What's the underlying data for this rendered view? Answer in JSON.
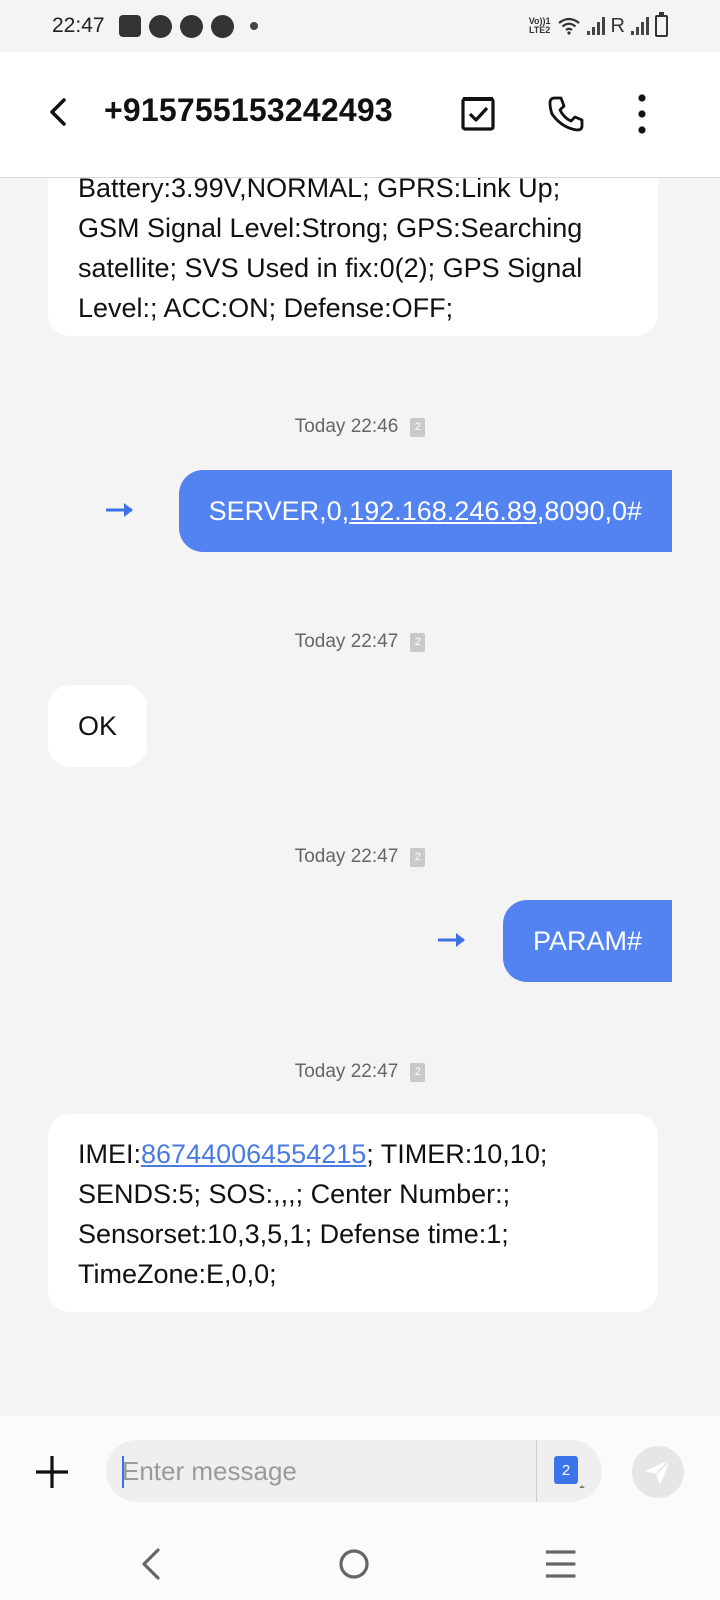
{
  "status_bar": {
    "time": "22:47",
    "network_label": "Vo)) 1 LTE2",
    "roaming": "R"
  },
  "header": {
    "title": "+915755153242493"
  },
  "messages": [
    {
      "kind": "incoming",
      "lines": [
        "Battery:3.99V,NORMAL; GPRS:Link Up;",
        "GSM Signal Level:Strong; GPS:Searching",
        "satellite; SVS Used in fix:0(2); GPS Signal",
        "Level:; ACC:ON; Defense:OFF;"
      ]
    },
    {
      "kind": "timestamp",
      "text": "Today 22:46",
      "sim": "2"
    },
    {
      "kind": "outgoing",
      "prefix": "SERVER,0,",
      "link": "192.168.246.89",
      "suffix": ",8090,0#"
    },
    {
      "kind": "timestamp",
      "text": "Today 22:47",
      "sim": "2"
    },
    {
      "kind": "incoming",
      "text": "OK"
    },
    {
      "kind": "timestamp",
      "text": "Today 22:47",
      "sim": "2"
    },
    {
      "kind": "outgoing",
      "text": "PARAM#"
    },
    {
      "kind": "timestamp",
      "text": "Today 22:47",
      "sim": "2"
    },
    {
      "kind": "incoming",
      "imei_label": "IMEI:",
      "imei_link": "867440064554215",
      "line1_rest": "; TIMER:10,10;",
      "line2": "SENDS:5; SOS:,,,; Center Number:;",
      "line3": "Sensorset:10,3,5,1; Defense time:1;",
      "line4": "TimeZone:E,0,0;"
    }
  ],
  "composer": {
    "placeholder": "Enter message",
    "sim_slot": "2"
  },
  "colors": {
    "outgoing_bubble": "#5383f1",
    "link": "#4a7ae3",
    "background": "#f4f4f4"
  },
  "icons": {
    "header": [
      "back-arrow-icon",
      "select-check-icon",
      "phone-icon",
      "more-vert-icon"
    ],
    "composer": [
      "plus-icon",
      "send-icon"
    ],
    "nav": [
      "nav-back-icon",
      "nav-home-icon",
      "nav-recent-icon"
    ]
  }
}
